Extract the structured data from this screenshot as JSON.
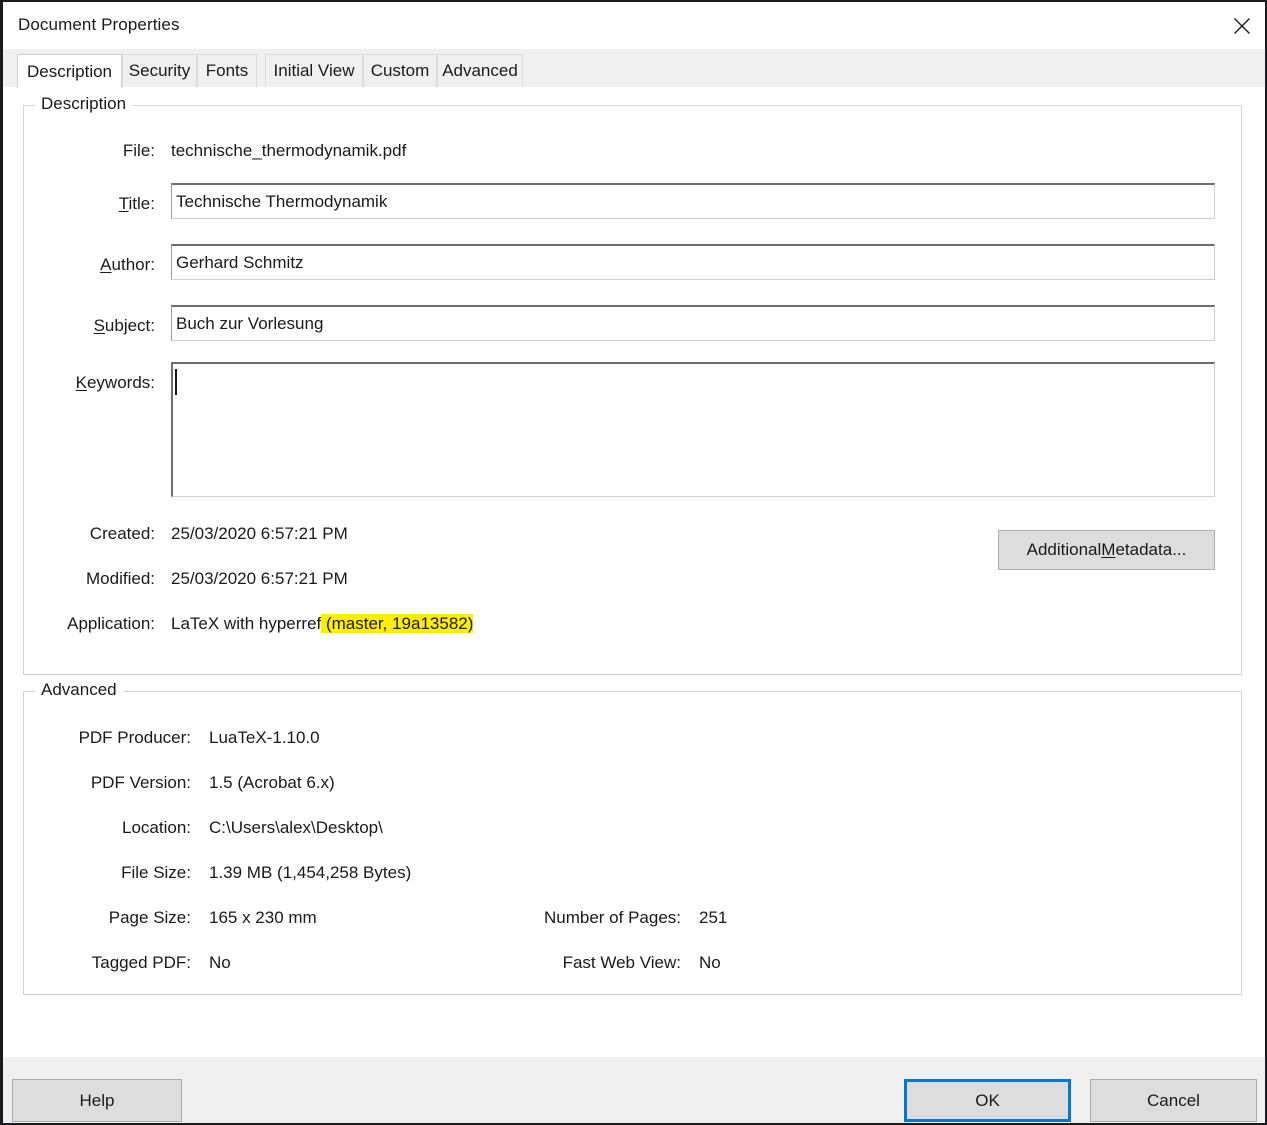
{
  "window": {
    "title": "Document Properties",
    "close_icon": "close-icon"
  },
  "tabs": [
    {
      "label": "Description",
      "active": true
    },
    {
      "label": "Security",
      "active": false
    },
    {
      "label": "Fonts",
      "active": false
    },
    {
      "label": "Initial View",
      "active": false
    },
    {
      "label": "Custom",
      "active": false
    },
    {
      "label": "Advanced",
      "active": false
    }
  ],
  "description_group": {
    "legend": "Description",
    "file": {
      "label": "File:",
      "value": "technische_thermodynamik.pdf"
    },
    "title": {
      "label_pre": "",
      "label_mnemonic": "T",
      "label_post": "itle:",
      "value": "Technische Thermodynamik"
    },
    "author": {
      "label_pre": "",
      "label_mnemonic": "A",
      "label_post": "uthor:",
      "value": "Gerhard Schmitz"
    },
    "subject": {
      "label_pre": "",
      "label_mnemonic": "S",
      "label_post": "ubject:",
      "value": "Buch zur Vorlesung"
    },
    "keywords": {
      "label_pre": "",
      "label_mnemonic": "K",
      "label_post": "eywords:",
      "value": ""
    },
    "created": {
      "label": "Created:",
      "value": "25/03/2020 6:57:21 PM"
    },
    "modified": {
      "label": "Modified:",
      "value": "25/03/2020 6:57:21 PM"
    },
    "application": {
      "label": "Application:",
      "value_plain": "LaTeX with hyperref",
      "value_highlighted": " (master, 19a13582)",
      "highlight_color": "#ffee00"
    },
    "additional_metadata_button": {
      "label_pre": "Additional ",
      "label_mnemonic": "M",
      "label_post": "etadata..."
    }
  },
  "advanced_group": {
    "legend": "Advanced",
    "rows_left": [
      {
        "label": "PDF Producer:",
        "value": "LuaTeX-1.10.0"
      },
      {
        "label": "PDF Version:",
        "value": "1.5 (Acrobat 6.x)"
      },
      {
        "label": "Location:",
        "value": "C:\\Users\\alex\\Desktop\\"
      },
      {
        "label": "File Size:",
        "value": "1.39 MB (1,454,258 Bytes)"
      },
      {
        "label": "Page Size:",
        "value": "165 x 230 mm"
      },
      {
        "label": "Tagged PDF:",
        "value": "No"
      }
    ],
    "rows_right": [
      {
        "label": "Number of Pages:",
        "value": "251"
      },
      {
        "label": "Fast Web View:",
        "value": "No"
      }
    ]
  },
  "footer": {
    "help_label": "Help",
    "ok_label": "OK",
    "cancel_label": "Cancel",
    "focus_color": "#0078d4"
  }
}
